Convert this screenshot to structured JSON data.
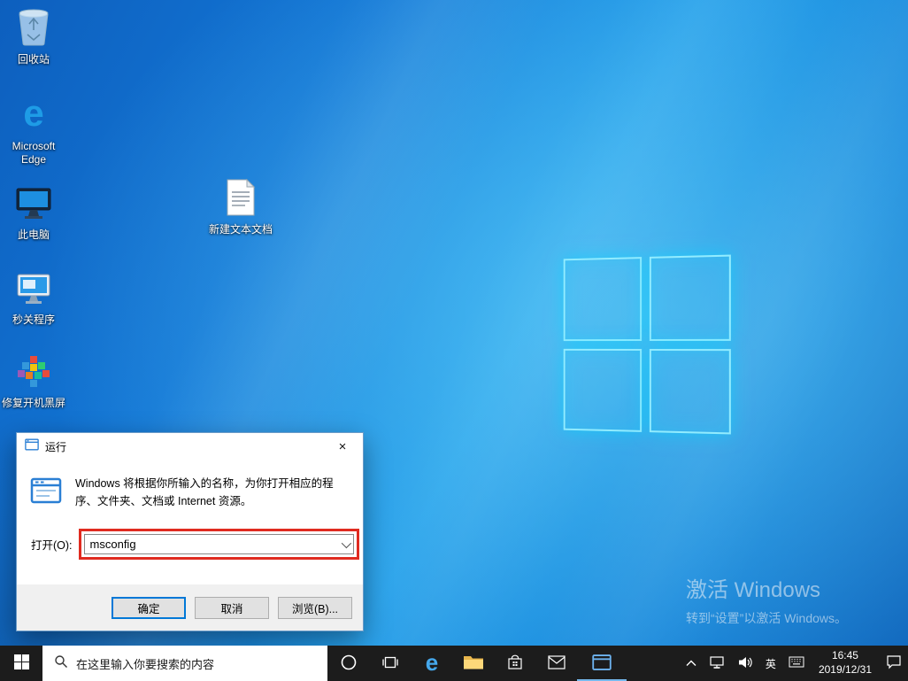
{
  "desktop": {
    "icons": [
      {
        "name": "recycle-bin",
        "label": "回收站"
      },
      {
        "name": "microsoft-edge",
        "label": "Microsoft Edge"
      },
      {
        "name": "this-pc",
        "label": "此电脑"
      },
      {
        "name": "quick-close-program",
        "label": "秒关程序"
      },
      {
        "name": "fix-boot-black-screen",
        "label": "修复开机黑屏"
      },
      {
        "name": "new-text-document",
        "label": "新建文本文档"
      }
    ],
    "activation": {
      "line1": "激活 Windows",
      "line2": "转到“设置”以激活 Windows。"
    }
  },
  "run_dialog": {
    "title": "运行",
    "close_glyph": "×",
    "description": "Windows 将根据你所输入的名称，为你打开相应的程序、文件夹、文档或 Internet 资源。",
    "open_label": "打开(O):",
    "input_value": "msconfig",
    "annotation_color": "#e02b20",
    "buttons": {
      "ok": "确定",
      "cancel": "取消",
      "browse": "浏览(B)..."
    }
  },
  "taskbar": {
    "search_placeholder": "在这里输入你要搜索的内容",
    "tray": {
      "ime": "英",
      "time": "16:45",
      "date": "2019/12/31"
    }
  }
}
